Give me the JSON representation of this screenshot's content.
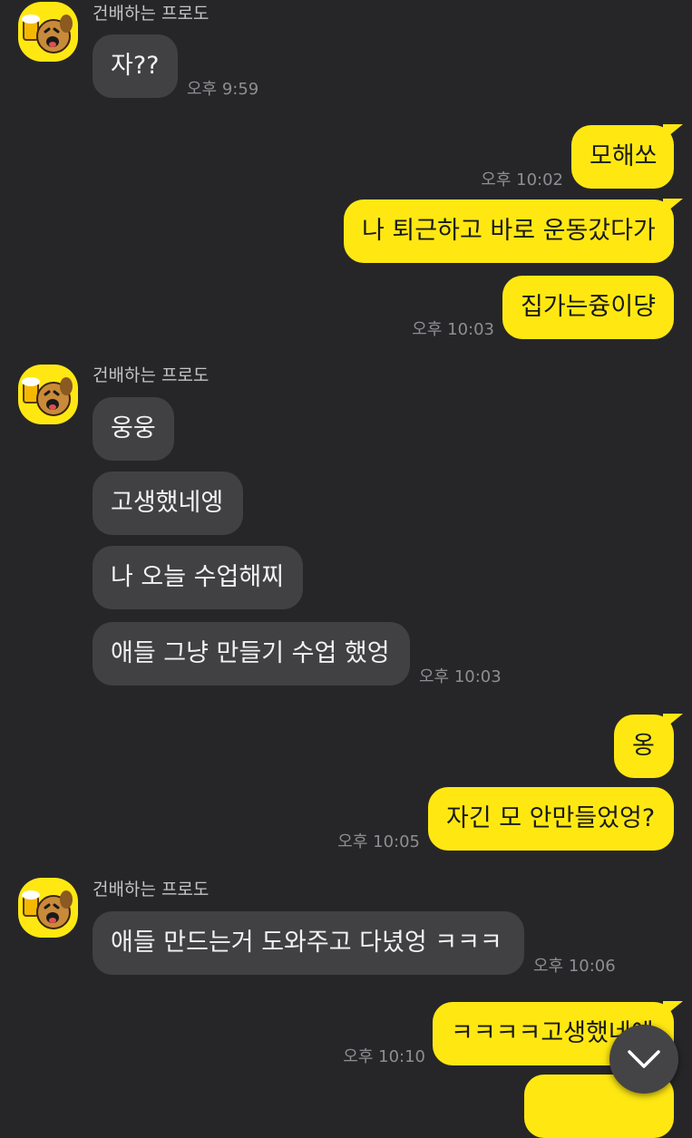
{
  "chat": {
    "sender_name": "건배하는 프로도",
    "groups": [
      {
        "sender": "건배하는 프로도",
        "messages": [
          "자??"
        ],
        "time": "오후 9:59"
      },
      {
        "messages": [
          "모해쏘"
        ],
        "time": "오후 10:02"
      },
      {
        "messages": [
          "나 퇴근하고 바로 운동갔다가",
          "집가는즁이댱"
        ],
        "time": "오후 10:03"
      },
      {
        "sender": "건배하는 프로도",
        "messages": [
          "웅웅",
          "고생했네엥",
          "나 오늘 수업해찌",
          "애들 그냥 만들기 수업 했엉"
        ],
        "time": "오후 10:03"
      },
      {
        "messages": [
          "옹",
          "자긴 모 안만들었엉?"
        ],
        "time": "오후 10:05"
      },
      {
        "sender": "건배하는 프로도",
        "messages": [
          "애들 만드는거 도와주고 다녔엉 ㅋㅋㅋ"
        ],
        "time": "오후 10:06"
      },
      {
        "messages": [
          "ㅋㅋㅋㅋ고생했네에"
        ],
        "time": "오후 10:10"
      }
    ]
  },
  "colors": {
    "background": "#262628",
    "incoming_bubble": "#414144",
    "outgoing_bubble": "#FFE812",
    "avatar_background": "#FFE812"
  },
  "icons": {
    "avatar": "beer-dog-avatar-icon",
    "scroll_down": "chevron-down-icon"
  }
}
